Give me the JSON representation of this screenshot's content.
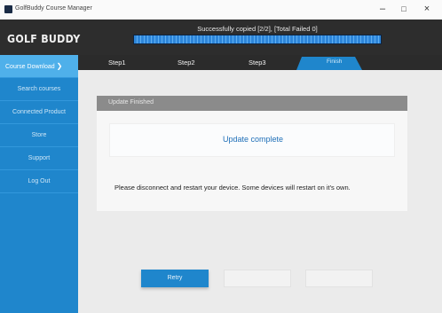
{
  "window": {
    "title": "GolfBuddy Course Manager",
    "minimize": "–",
    "maximize": "□",
    "close": "×"
  },
  "header": {
    "logo": "GOLF BUDDY",
    "status": "Successfully copied [2/2], [Total Failed 0]",
    "progress_percent": 100,
    "progress_color": "#2e86da"
  },
  "sidebar": {
    "items": [
      {
        "label": "Course Download",
        "active": true
      },
      {
        "label": "Search courses",
        "active": false
      },
      {
        "label": "Connected Product",
        "active": false
      },
      {
        "label": "Store",
        "active": false
      },
      {
        "label": "Support",
        "active": false
      },
      {
        "label": "Log Out",
        "active": false
      }
    ],
    "active_chevron": "❯",
    "color": "#1f86cc"
  },
  "steps": {
    "step1": "Step1",
    "step2": "Step2",
    "step3": "Step3",
    "finish": "Finish",
    "current": "Finish"
  },
  "panel": {
    "header": "Update Finished",
    "complete_message": "Update complete",
    "instruction": "Please disconnect and restart your device. Some devices will restart on it's own."
  },
  "buttons": {
    "retry": "Retry",
    "disabled_1": "",
    "disabled_2": ""
  },
  "colors": {
    "accent": "#1f86cc",
    "header_bg": "#2d2d2d"
  }
}
